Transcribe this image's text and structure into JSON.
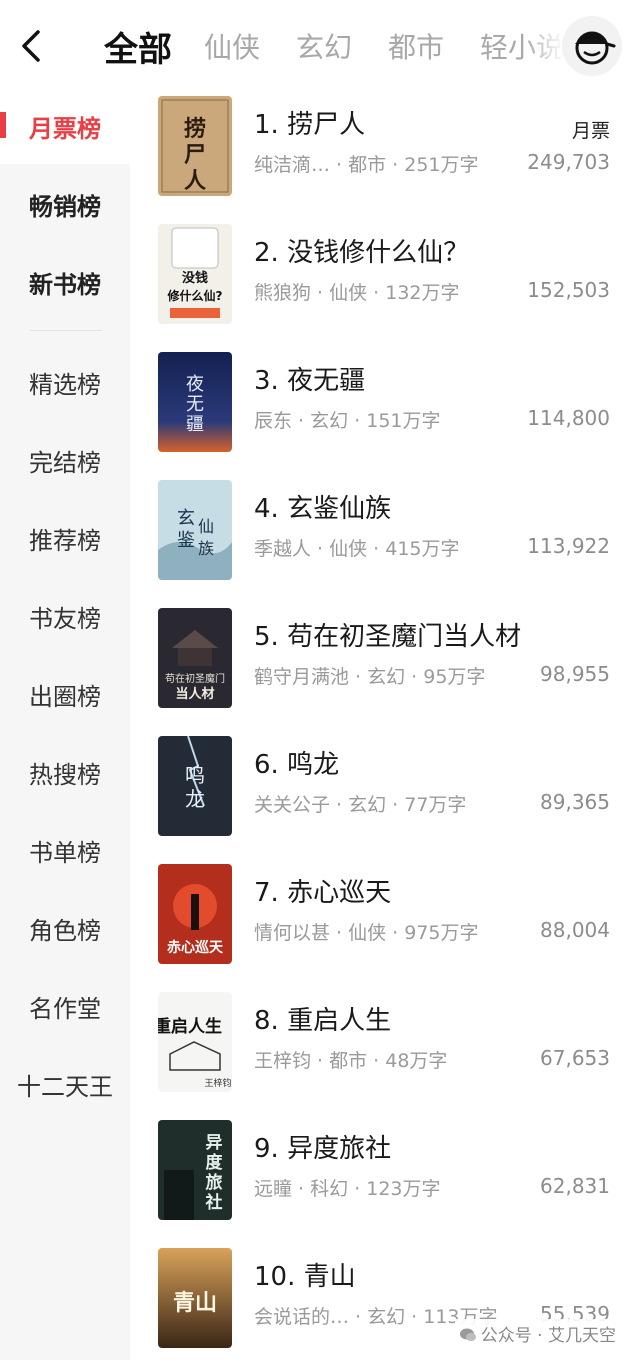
{
  "header": {
    "tabs": [
      {
        "label": "全部",
        "active": true
      },
      {
        "label": "仙侠"
      },
      {
        "label": "玄幻"
      },
      {
        "label": "都市"
      },
      {
        "label": "轻小说"
      }
    ]
  },
  "sidebar": {
    "items": [
      {
        "label": "月票榜",
        "active": true
      },
      {
        "label": "畅销榜"
      },
      {
        "label": "新书榜"
      },
      {
        "label": "精选榜"
      },
      {
        "label": "完结榜"
      },
      {
        "label": "推荐榜"
      },
      {
        "label": "书友榜"
      },
      {
        "label": "出圈榜"
      },
      {
        "label": "热搜榜"
      },
      {
        "label": "书单榜"
      },
      {
        "label": "角色榜"
      },
      {
        "label": "名作堂"
      },
      {
        "label": "十二天王"
      }
    ]
  },
  "list": {
    "column_label": "月票",
    "books": [
      {
        "title": "1. 捞尸人",
        "meta": "纯洁滴…  · 都市 · 251万字",
        "count": "249,703",
        "cover_text": "捞尸人",
        "cover_color": "#c9a67a"
      },
      {
        "title": "2. 没钱修什么仙？",
        "meta": "熊狼狗 · 仙侠 · 132万字",
        "count": "152,503",
        "cover_text": "没钱修什么仙",
        "cover_color": "#f3f0ea"
      },
      {
        "title": "3. 夜无疆",
        "meta": "辰东 · 玄幻 · 151万字",
        "count": "114,800",
        "cover_text": "夜无疆",
        "cover_color": "#1e2a5a"
      },
      {
        "title": "4. 玄鉴仙族",
        "meta": "季越人 · 仙侠 · 415万字",
        "count": "113,922",
        "cover_text": "玄鉴仙族",
        "cover_color": "#b7d2de"
      },
      {
        "title": "5. 苟在初圣魔门当人材",
        "meta": "鹤守月满池 · 玄幻 · 95万字",
        "count": "98,955",
        "cover_text": "苟在初圣魔门当人材",
        "cover_color": "#2c2a30"
      },
      {
        "title": "6. 鸣龙",
        "meta": "关关公子 · 玄幻 · 77万字",
        "count": "89,365",
        "cover_text": "鸣龙",
        "cover_color": "#2a3340"
      },
      {
        "title": "7. 赤心巡天",
        "meta": "情何以甚 · 仙侠 · 975万字",
        "count": "88,004",
        "cover_text": "赤心巡天",
        "cover_color": "#b8321f"
      },
      {
        "title": "8. 重启人生",
        "meta": "王梓钧 · 都市 · 48万字",
        "count": "67,653",
        "cover_text": "重启人生",
        "cover_color": "#f4f4f2"
      },
      {
        "title": "9. 异度旅社",
        "meta": "远瞳 · 科幻 · 123万字",
        "count": "62,831",
        "cover_text": "异度旅社",
        "cover_color": "#243c36"
      },
      {
        "title": "10. 青山",
        "meta": "会说话的…  · 玄幻 · 113万字",
        "count": "55,539",
        "cover_text": "青山",
        "cover_color": "#6b4a2a"
      }
    ]
  },
  "watermark": {
    "text": "公众号 · 艾几天空"
  }
}
